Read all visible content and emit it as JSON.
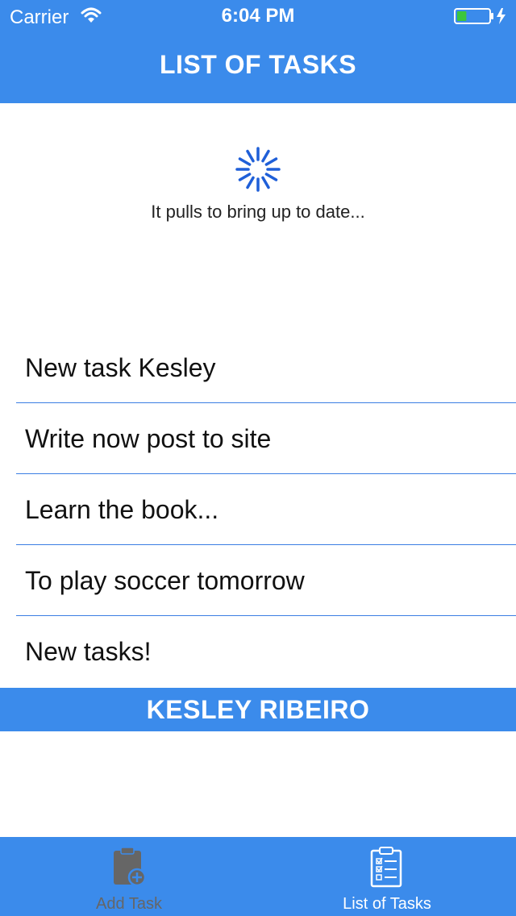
{
  "status_bar": {
    "carrier": "Carrier",
    "time": "6:04 PM",
    "battery_level": 0.3
  },
  "nav": {
    "title": "LIST OF TASKS"
  },
  "refresh": {
    "text": "It pulls to bring up to date..."
  },
  "tasks": [
    {
      "title": "New task Kesley"
    },
    {
      "title": "Write now post to site"
    },
    {
      "title": "Learn the book..."
    },
    {
      "title": "To play soccer tomorrow"
    },
    {
      "title": "New tasks!"
    }
  ],
  "footer": {
    "name": "KESLEY RIBEIRO"
  },
  "tab_bar": {
    "tabs": [
      {
        "label": "Add Task",
        "icon": "clipboard-add-icon",
        "selected": false
      },
      {
        "label": "List of Tasks",
        "icon": "clipboard-list-icon",
        "selected": true
      }
    ]
  },
  "colors": {
    "primary": "#3b8beb",
    "separator": "#3b7ee3",
    "spinner": "#1f5fd8",
    "battery_fill": "#3cc63c",
    "tab_inactive": "#666666",
    "tab_active": "#ffffff"
  }
}
